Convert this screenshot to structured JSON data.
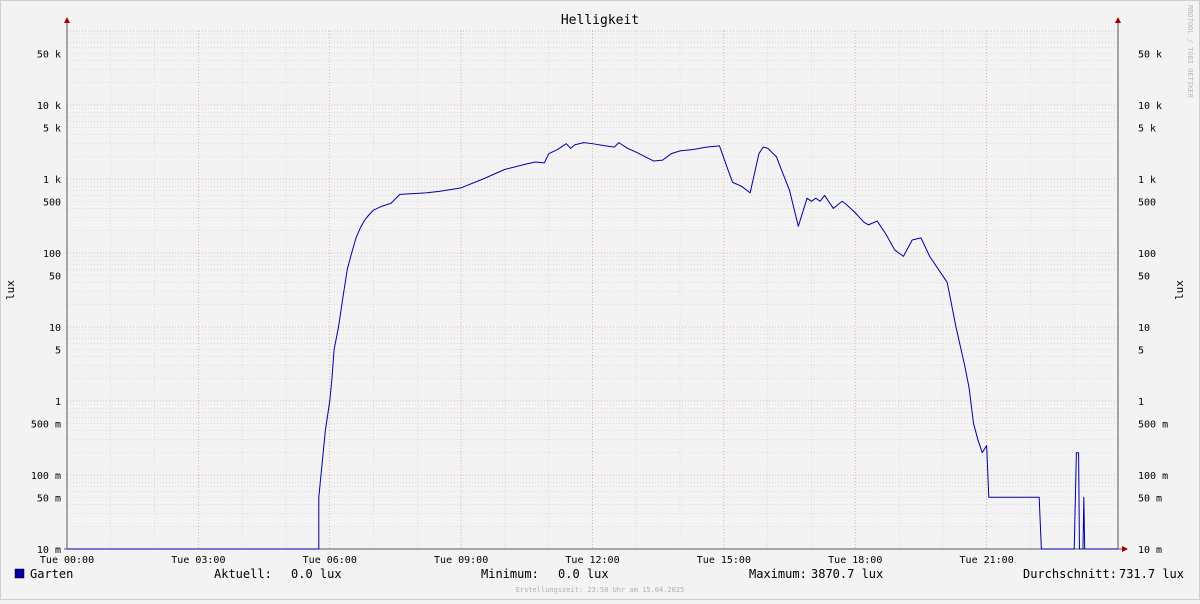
{
  "chart_data": {
    "type": "line",
    "title": "Helligkeit",
    "ylabel_left": "lux",
    "ylabel_right": "lux",
    "yscale": "log",
    "ylim": [
      0.01,
      100000
    ],
    "x_tick_labels": [
      "Tue 00:00",
      "Tue 03:00",
      "Tue 06:00",
      "Tue 09:00",
      "Tue 12:00",
      "Tue 15:00",
      "Tue 18:00",
      "Tue 21:00"
    ],
    "y_ticks": [
      {
        "value": 0.01,
        "label": "10 m"
      },
      {
        "value": 0.05,
        "label": "50 m"
      },
      {
        "value": 0.1,
        "label": "100 m"
      },
      {
        "value": 0.5,
        "label": "500 m"
      },
      {
        "value": 1,
        "label": "1"
      },
      {
        "value": 5,
        "label": "5"
      },
      {
        "value": 10,
        "label": "10"
      },
      {
        "value": 50,
        "label": "50"
      },
      {
        "value": 100,
        "label": "100"
      },
      {
        "value": 500,
        "label": "500"
      },
      {
        "value": 1000,
        "label": "1 k"
      },
      {
        "value": 5000,
        "label": "5 k"
      },
      {
        "value": 10000,
        "label": "10 k"
      },
      {
        "value": 50000,
        "label": "50 k"
      }
    ],
    "series": [
      {
        "name": "Garten",
        "color": "#0000a0",
        "x_hours": [
          0,
          5.75,
          5.75,
          5.8,
          5.85,
          5.9,
          6.0,
          6.05,
          6.1,
          6.2,
          6.3,
          6.4,
          6.5,
          6.6,
          6.7,
          6.8,
          6.9,
          7.0,
          7.2,
          7.4,
          7.6,
          7.8,
          8.0,
          8.2,
          8.5,
          9.0,
          9.5,
          10.0,
          10.5,
          10.7,
          10.9,
          11.0,
          11.2,
          11.4,
          11.5,
          11.6,
          11.8,
          12.0,
          12.3,
          12.5,
          12.6,
          12.8,
          13.0,
          13.2,
          13.4,
          13.6,
          13.8,
          14.0,
          14.3,
          14.6,
          14.9,
          15.1,
          15.2,
          15.4,
          15.6,
          15.8,
          15.9,
          16.0,
          16.2,
          16.3,
          16.5,
          16.7,
          16.9,
          17.0,
          17.1,
          17.2,
          17.3,
          17.5,
          17.7,
          17.8,
          18.0,
          18.2,
          18.3,
          18.5,
          18.7,
          18.9,
          19.1,
          19.3,
          19.5,
          19.7,
          19.9,
          20.1,
          20.3,
          20.5,
          20.6,
          20.7,
          20.8,
          20.9,
          21.0,
          21.05,
          21.15,
          21.25,
          21.3,
          22.2,
          22.25,
          23.0,
          23.05,
          23.1,
          23.12,
          23.2,
          23.22,
          23.24,
          23.3,
          24.0
        ],
        "y_lux": [
          0.01,
          0.01,
          0.05,
          0.1,
          0.2,
          0.4,
          1.0,
          2.0,
          5.0,
          10,
          25,
          60,
          100,
          160,
          220,
          280,
          330,
          380,
          430,
          470,
          620,
          630,
          640,
          650,
          680,
          760,
          1000,
          1350,
          1600,
          1700,
          1650,
          2200,
          2500,
          3000,
          2600,
          2900,
          3100,
          3000,
          2800,
          2700,
          3100,
          2600,
          2300,
          2000,
          1750,
          1800,
          2200,
          2400,
          2500,
          2700,
          2800,
          1300,
          900,
          800,
          650,
          2200,
          2700,
          2600,
          2000,
          1400,
          700,
          230,
          550,
          500,
          550,
          500,
          600,
          400,
          500,
          450,
          350,
          260,
          240,
          270,
          180,
          110,
          90,
          150,
          160,
          90,
          60,
          40,
          10,
          3,
          1.5,
          0.5,
          0.3,
          0.2,
          0.25,
          0.05,
          0.05,
          0.05,
          0.05,
          0.05,
          0.01,
          0.01,
          0.2,
          0.2,
          0.01,
          0.01,
          0.05,
          0.01,
          0.01,
          0.01
        ]
      }
    ],
    "legend_placement": "bottom-left",
    "grid": true
  },
  "legend": {
    "swatch_color": "#0000a0",
    "series_name": "Garten",
    "aktuell_label": "Aktuell:",
    "aktuell_value": "0.0 lux",
    "minimum_label": "Minimum:",
    "minimum_value": "0.0 lux",
    "maximum_label": "Maximum:",
    "maximum_value": "3870.7 lux",
    "durchschnitt_label": "Durchschnitt:",
    "durchschnitt_value": "731.7 lux"
  },
  "footer_text": "Erstellungszeit: 23:58 Uhr am 15.04.2025",
  "watermark_text": "RRDTOOL / TOBI OETIKER",
  "colors": {
    "major_grid": "#e08080",
    "minor_grid": "#d0d0d0",
    "axis": "#555555",
    "arrow": "#a00000"
  }
}
